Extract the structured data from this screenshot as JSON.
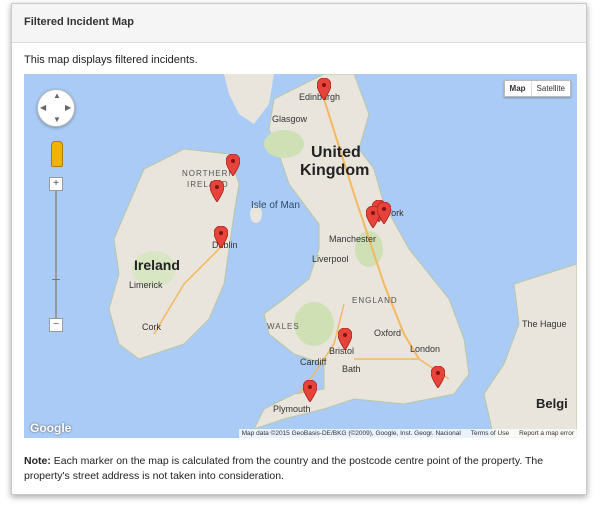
{
  "panel": {
    "title": "Filtered Incident Map"
  },
  "intro": "This map displays filtered incidents.",
  "map": {
    "type_buttons": [
      "Map",
      "Satellite"
    ],
    "active_type": "Map",
    "labels": {
      "edinburgh": "Edinburgh",
      "glasgow": "Glasgow",
      "united_kingdom_line1": "United",
      "united_kingdom_line2": "Kingdom",
      "northern_ireland_line1": "NORTHERN",
      "northern_ireland_line2": "IRELAND",
      "isle_of_man": "Isle of Man",
      "york": "York",
      "manchester": "Manchester",
      "liverpool": "Liverpool",
      "ireland": "Ireland",
      "dublin": "Dublin",
      "limerick": "Limerick",
      "cork": "Cork",
      "england": "ENGLAND",
      "wales": "WALES",
      "oxford": "Oxford",
      "bristol": "Bristol",
      "cardiff": "Cardiff",
      "bath": "Bath",
      "london": "London",
      "plymouth": "Plymouth",
      "the_hague": "The Hague",
      "belgium": "Belgi"
    },
    "zoom": {
      "in": "+",
      "out": "−"
    },
    "attribution": {
      "data": "Map data ©2015 GeoBasis-DE/BKG (©2009), Google, Inst. Geogr. Nacional",
      "terms": "Terms of Use",
      "report": "Report a map error"
    },
    "logo": "Google",
    "marker_color": "#e8433b",
    "marker_count": 10
  },
  "note": {
    "prefix": "Note:",
    "text": " Each marker on the map is calculated from the country and the postcode centre point of the property. The property's street address is not taken into consideration."
  }
}
